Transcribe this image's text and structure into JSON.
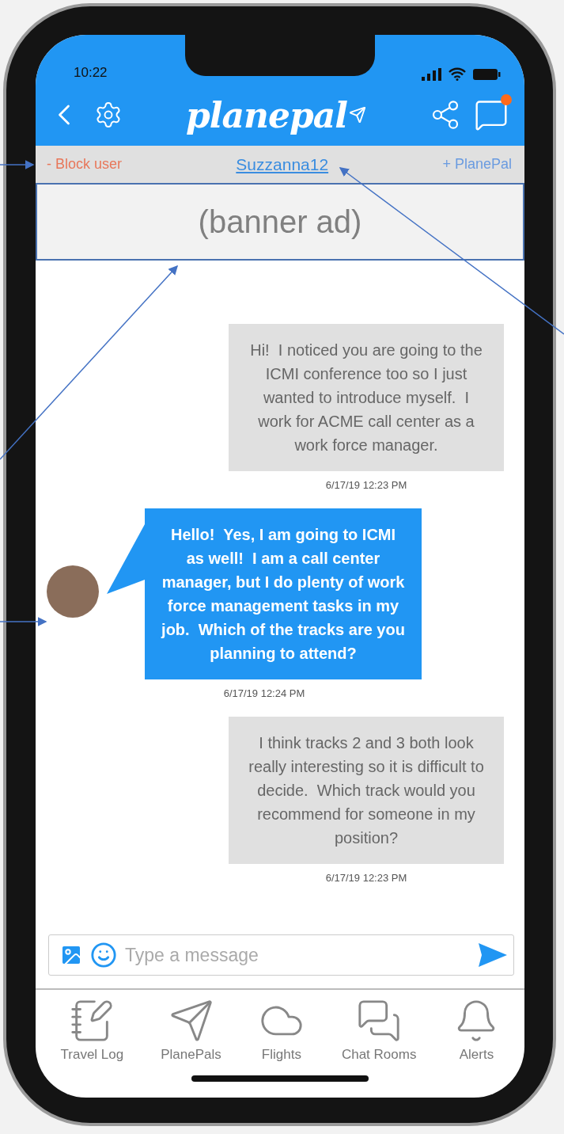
{
  "status_bar": {
    "time": "10:22"
  },
  "header": {
    "logo": "planepal",
    "notification_badge": true
  },
  "subheader": {
    "block_action": "- Block user",
    "username": "Suzzanna12",
    "add_action": "+ PlanePal"
  },
  "banner": {
    "text": "(banner ad)"
  },
  "messages": [
    {
      "kind": "sent",
      "text": "Hi!  I noticed you are going to the ICMI conference too so I just wanted to introduce myself.  I work for ACME call center as a work force manager.",
      "time": "6/17/19 12:23 PM"
    },
    {
      "kind": "received",
      "text": "Hello!  Yes, I am going to ICMI as well!  I am a call center manager, but I do plenty of work force management tasks in my job.  Which of the tracks are you planning to attend?",
      "time": "6/17/19 12:24 PM"
    },
    {
      "kind": "sent",
      "text": "I think tracks 2 and 3 both look really interesting so it is difficult to decide.  Which track would you recommend for someone in my position?",
      "time": "6/17/19 12:23 PM"
    }
  ],
  "composer": {
    "placeholder": "Type a message"
  },
  "nav": [
    {
      "kind": "log",
      "label": "Travel Log"
    },
    {
      "kind": "plane",
      "label": "PlanePals"
    },
    {
      "kind": "cloud",
      "label": "Flights"
    },
    {
      "kind": "chat",
      "label": "Chat Rooms"
    },
    {
      "kind": "bell",
      "label": "Alerts"
    }
  ]
}
